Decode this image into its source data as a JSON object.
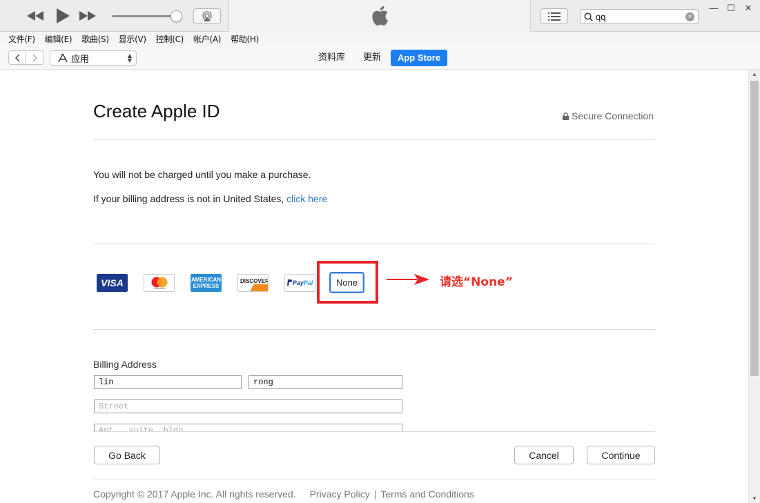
{
  "player": {
    "search_value": "qq",
    "search_placeholder": ""
  },
  "menubar": {
    "items": [
      "文件(F)",
      "编辑(E)",
      "歌曲(S)",
      "显示(V)",
      "控制(C)",
      "帐户(A)",
      "帮助(H)"
    ]
  },
  "navbar": {
    "media_select": "应用",
    "tabs": {
      "library": "资料库",
      "updates": "更新",
      "store": "App Store"
    }
  },
  "page": {
    "title": "Create Apple ID",
    "secure": "Secure Connection",
    "charge_note": "You will not be charged until you make a purchase.",
    "billing_note_prefix": "If your billing address is not in United States, ",
    "billing_note_link": "click here"
  },
  "payment": {
    "cards": {
      "visa": "VISA",
      "amex_line1": "AMERICAN",
      "amex_line2": "EXPRESS",
      "discover": "DISCOVER",
      "paypal_a": "Pay",
      "paypal_b": "Pal"
    },
    "none_label": "None",
    "annotation": "请选“None”"
  },
  "billing": {
    "label": "Billing Address",
    "first_name": "lin",
    "last_name": "rong",
    "street_placeholder": "Street",
    "apt_placeholder": "Apt., suite, bldg."
  },
  "actions": {
    "go_back": "Go Back",
    "cancel": "Cancel",
    "continue": "Continue"
  },
  "footer": {
    "copyright": "Copyright © 2017 Apple Inc. All rights reserved.",
    "privacy": "Privacy Policy",
    "separator": "|",
    "terms": "Terms and Conditions"
  },
  "colors": {
    "accent": "#1d7ef2",
    "link": "#2a76c6",
    "annotation_red": "#e8232a"
  }
}
